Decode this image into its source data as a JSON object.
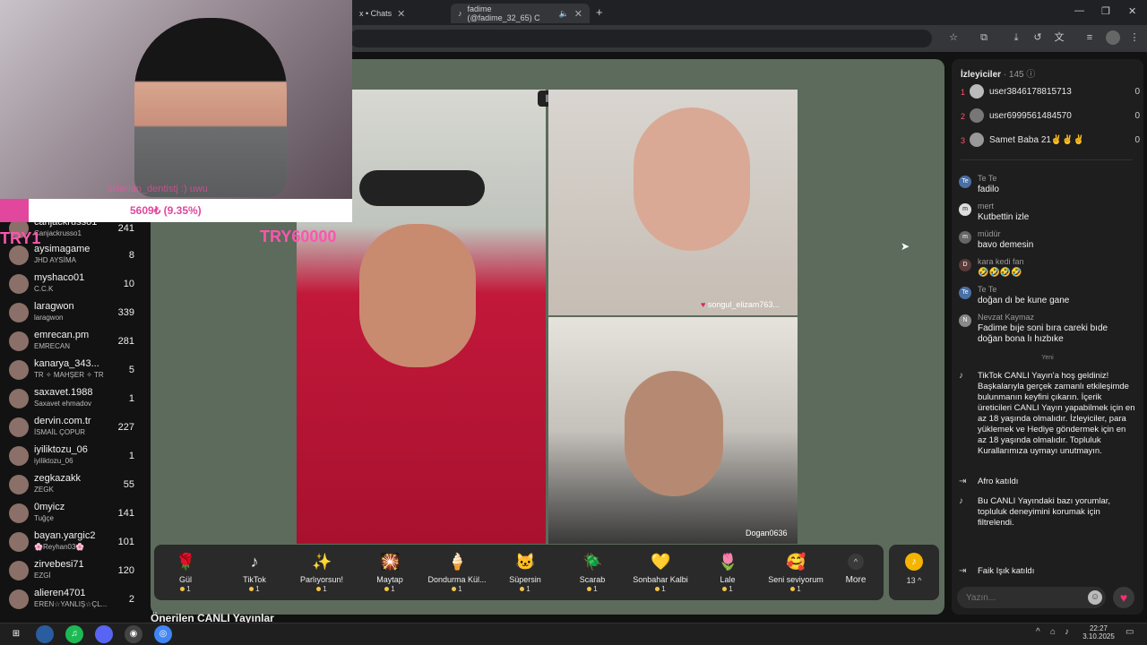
{
  "browser": {
    "tabs": [
      {
        "label": "x • Chats"
      },
      {
        "label": "fadime (@fadime_32_65) C"
      }
    ],
    "new_tab": "+"
  },
  "webcam": {
    "caption": "skierian_dentistj :) uwu",
    "progress_text": "5609₺ (9.35%)",
    "progress_fraction": 0.0935,
    "overlay_left": "TRY1",
    "overlay_right": "TRY60000"
  },
  "leaderboard": [
    {
      "name": "canjackrusso1",
      "sub": "Canjackrusso1",
      "count": "241"
    },
    {
      "name": "aysimagame",
      "sub": "JHD AYSİMA",
      "count": "8"
    },
    {
      "name": "myshaco01",
      "sub": "C.C.K",
      "count": "10"
    },
    {
      "name": "laragwon",
      "sub": "laragwon",
      "count": "339"
    },
    {
      "name": "emrecan.pm",
      "sub": "EMRECAN",
      "count": "281"
    },
    {
      "name": "kanarya_343...",
      "sub": "TR ✧ MAHŞER ✧ TR",
      "count": "5"
    },
    {
      "name": "saxavet.1988",
      "sub": "Saxavet ehmadov",
      "count": "1"
    },
    {
      "name": "dervin.com.tr",
      "sub": "İSMAİL ÇOPUR",
      "count": "227"
    },
    {
      "name": "iyiliktozu_06",
      "sub": "iyiliktozu_06",
      "count": "1"
    },
    {
      "name": "zegkazakk",
      "sub": "ZEGK",
      "count": "55"
    },
    {
      "name": "0myicz",
      "sub": "Tuğçe",
      "count": "141"
    },
    {
      "name": "bayan.yargic2",
      "sub": "🌸Reyhan03🌸",
      "count": "101"
    },
    {
      "name": "zirvebesi71",
      "sub": "EZGİ",
      "count": "120"
    },
    {
      "name": "alieren4701",
      "sub": "EREN☆YANLIŞ☆ÇL...",
      "count": "2"
    }
  ],
  "stage": {
    "panel_user_top": "songul_elizam763...",
    "panel_user_bottom": "Dogan0636"
  },
  "gifts": [
    {
      "label": "Gül",
      "price": "1",
      "icon": "🌹"
    },
    {
      "label": "TikTok",
      "price": "1",
      "icon": "♪"
    },
    {
      "label": "Parlıyorsun!",
      "price": "1",
      "icon": "✨"
    },
    {
      "label": "Maytap",
      "price": "1",
      "icon": "🎇"
    },
    {
      "label": "Dondurma Kül...",
      "price": "1",
      "icon": "🍦"
    },
    {
      "label": "Süpersin",
      "price": "1",
      "icon": "🐱"
    },
    {
      "label": "Scarab",
      "price": "1",
      "icon": "🪲"
    },
    {
      "label": "Sonbahar Kalbi",
      "price": "1",
      "icon": "💛"
    },
    {
      "label": "Lale",
      "price": "1",
      "icon": "🌷"
    },
    {
      "label": "Seni seviyorum",
      "price": "1",
      "icon": "🥰"
    }
  ],
  "more_label": "More",
  "coin_count": "13",
  "suggested_title": "Önerilen CANLI Yayınlar",
  "viewers": {
    "title": "İzleyiciler",
    "count": "· 145",
    "list": [
      {
        "rank": "1",
        "name": "user3846178815713",
        "score": "0"
      },
      {
        "rank": "2",
        "name": "user6999561484570",
        "score": "0"
      },
      {
        "rank": "3",
        "name": "Samet Baba 21✌️✌️✌️",
        "score": "0"
      }
    ]
  },
  "comments": [
    {
      "avatar": "Te",
      "name": "Te Te",
      "text": "fadilo"
    },
    {
      "avatar": "m",
      "name": "mert",
      "text": "Kutbettin izle"
    },
    {
      "avatar": "m",
      "name": "müdür",
      "text": "bavo demesin"
    },
    {
      "avatar": "D",
      "name": "kara kedi fan",
      "text": "🤣🤣🤣🤣"
    },
    {
      "avatar": "Te",
      "name": "Te Te",
      "text": "doğan dı be kune gane"
    },
    {
      "avatar": "N",
      "name": "Nevzat Kaymaz",
      "text": "Fadime bıje soni bıra careki bıde doğan bona lı hızbıke"
    }
  ],
  "new_divider": "Yeni",
  "system": [
    {
      "text": "TikTok CANLI Yayın'a hoş geldiniz! Başkalarıyla gerçek zamanlı etkileşimde bulunmanın keyfini çıkarın. İçerik üreticileri CANLI Yayın yapabilmek için en az 18 yaşında olmalıdır. İzleyiciler, para yüklemek ve Hediye göndermek için en az 18 yaşında olmalıdır. Topluluk Kurallarımıza uymayı unutmayın."
    },
    {
      "text": "Afro  katıldı"
    },
    {
      "text": "Bu CANLI Yayındaki bazı yorumlar, topluluk deneyimini korumak için filtrelendi."
    },
    {
      "text": "Faik Işık  katıldı"
    }
  ],
  "chat_placeholder": "Yazın...",
  "clock": {
    "time": "22:27",
    "date": "3.10.2025"
  }
}
